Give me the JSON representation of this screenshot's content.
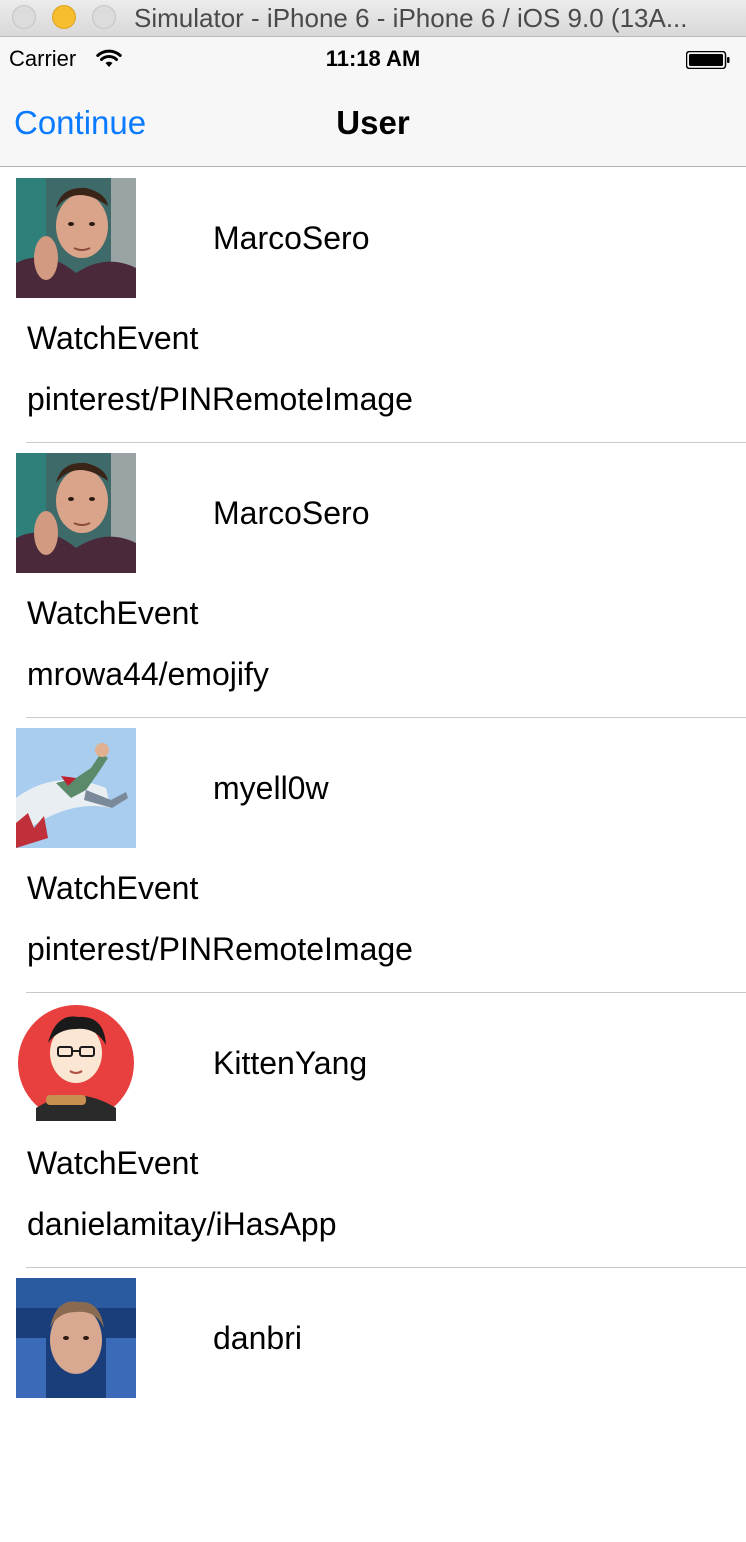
{
  "window": {
    "title": "Simulator - iPhone 6 - iPhone 6 / iOS 9.0 (13A..."
  },
  "status_bar": {
    "carrier": "Carrier",
    "time": "11:18 AM",
    "wifi_icon": "wifi-icon",
    "battery_icon": "battery-icon"
  },
  "nav": {
    "left_button": "Continue",
    "title": "User",
    "tint_color": "#0a7aff"
  },
  "feed": [
    {
      "username": "MarcoSero",
      "event": "WatchEvent",
      "repo": "pinterest/PINRemoteImage",
      "avatar": "photo-portrait-man"
    },
    {
      "username": "MarcoSero",
      "event": "WatchEvent",
      "repo": "mrowa44/emojify",
      "avatar": "photo-portrait-man"
    },
    {
      "username": "myell0w",
      "event": "WatchEvent",
      "repo": "pinterest/PINRemoteImage",
      "avatar": "photo-jumping-person-sky"
    },
    {
      "username": "KittenYang",
      "event": "WatchEvent",
      "repo": "danielamitay/iHasApp",
      "avatar": "illustration-cartoon-boy-circle"
    },
    {
      "username": "danbri",
      "event": "",
      "repo": "",
      "avatar": "photo-portrait-man-blue"
    }
  ]
}
